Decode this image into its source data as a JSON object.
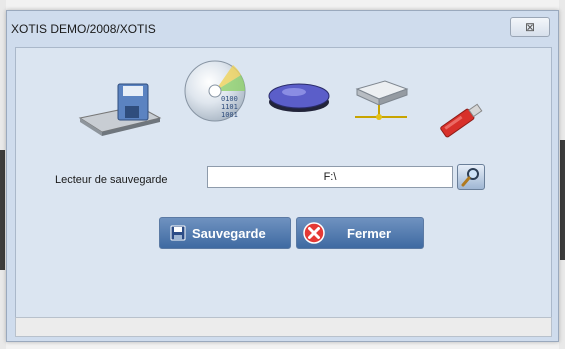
{
  "window": {
    "title": "XOTIS DEMO/2008/XOTIS",
    "close_glyph": "⊠"
  },
  "form": {
    "drive_label": "Lecteur de sauvegarde",
    "drive_value": "F:\\"
  },
  "buttons": {
    "save_label": "Sauvegarde",
    "close_label": "Fermer"
  },
  "icons": [
    "floppy-drive-icon",
    "cd-disc-icon",
    "external-drive-icon",
    "network-drive-icon",
    "usb-stick-icon",
    "magnifier-icon",
    "save-icon",
    "close-x-icon"
  ],
  "colors": {
    "window_bg": "#cfdced",
    "client_bg": "#dbe5f1",
    "button_blue": "#4a73a8",
    "close_red": "#e53935"
  }
}
